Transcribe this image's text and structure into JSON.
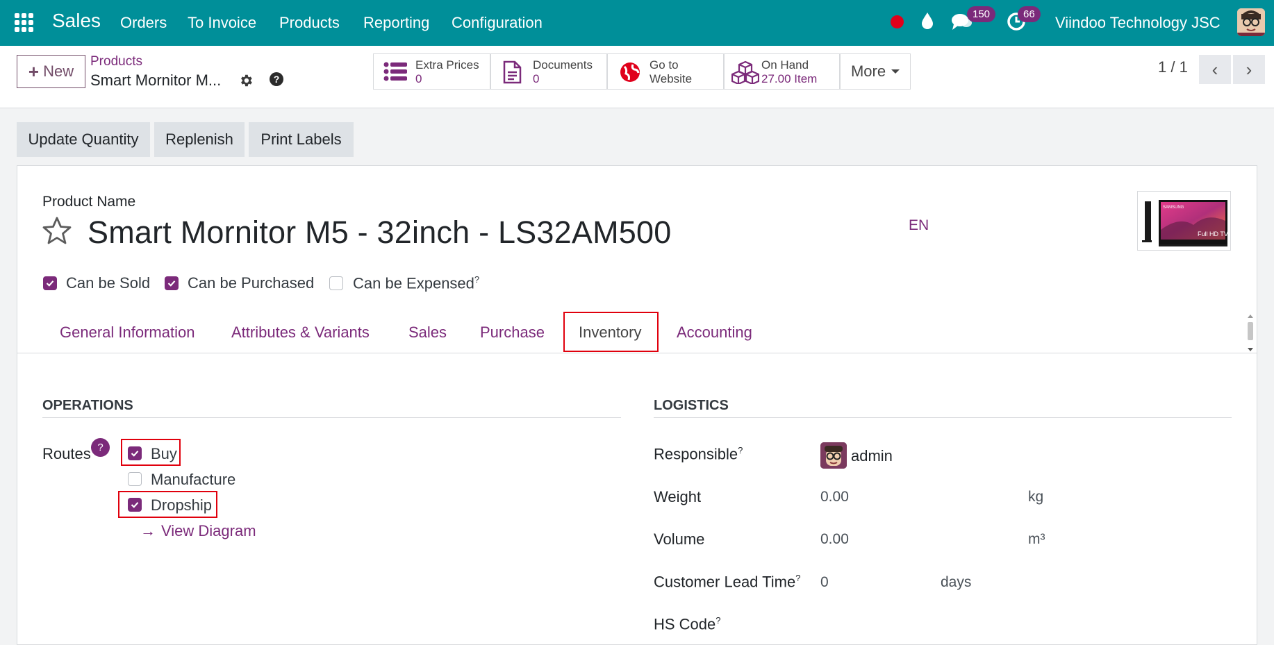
{
  "navbar": {
    "app_name": "Sales",
    "menu": [
      "Orders",
      "To Invoice",
      "Products",
      "Reporting",
      "Configuration"
    ],
    "messages_count": "150",
    "activities_count": "66",
    "company": "Viindoo Technology JSC",
    "brand_color": "#008f99"
  },
  "control": {
    "new_label": "New",
    "breadcrumb_parent": "Products",
    "breadcrumb_current": "Smart Mornitor M...",
    "smart_buttons": [
      {
        "label": "Extra Prices",
        "value": "0",
        "icon": "list-icon"
      },
      {
        "label": "Documents",
        "value": "0",
        "icon": "document-icon"
      },
      {
        "label": "Go to",
        "value": "Website",
        "icon": "globe-icon"
      },
      {
        "label": "On Hand",
        "value": "27.00 Item",
        "icon": "cubes-icon"
      }
    ],
    "more_label": "More",
    "pager": "1 / 1"
  },
  "actions": [
    "Update Quantity",
    "Replenish",
    "Print Labels"
  ],
  "form": {
    "product_name_label": "Product Name",
    "product_name": "Smart Mornitor M5 - 32inch - LS32AM500",
    "lang": "EN",
    "checkboxes": [
      {
        "label": "Can be Sold",
        "checked": true
      },
      {
        "label": "Can be Purchased",
        "checked": true
      },
      {
        "label": "Can be Expensed",
        "checked": false,
        "help": "?"
      }
    ],
    "tabs": [
      "General Information",
      "Attributes & Variants",
      "Sales",
      "Purchase",
      "Inventory",
      "Accounting"
    ],
    "active_tab": "Inventory",
    "operations": {
      "title": "OPERATIONS",
      "routes_label": "Routes",
      "help": "?",
      "routes": [
        {
          "label": "Buy",
          "checked": true
        },
        {
          "label": "Manufacture",
          "checked": false
        },
        {
          "label": "Dropship",
          "checked": true
        }
      ],
      "view_diagram": "View Diagram"
    },
    "logistics": {
      "title": "LOGISTICS",
      "responsible_label": "Responsible",
      "responsible_value": "admin",
      "weight_label": "Weight",
      "weight_value": "0.00",
      "weight_unit": "kg",
      "volume_label": "Volume",
      "volume_value": "0.00",
      "volume_unit": "m³",
      "lead_time_label": "Customer Lead Time",
      "lead_time_value": "0",
      "lead_time_unit": "days",
      "hs_code_label": "HS Code",
      "help": "?"
    },
    "image_text": {
      "brand": "SAMSUNG",
      "caption": "Full HD TV"
    }
  }
}
